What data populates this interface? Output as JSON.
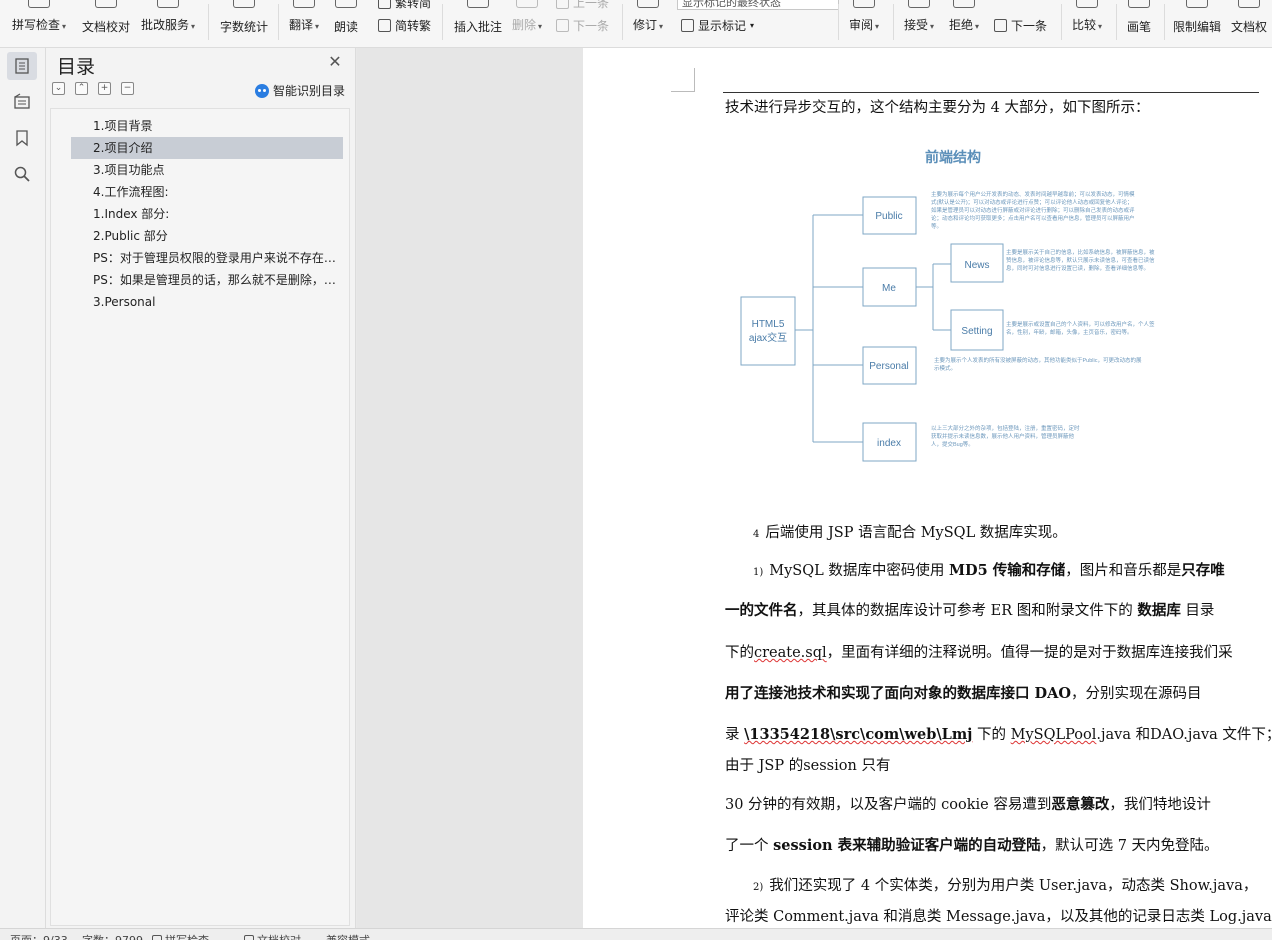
{
  "ribbon": {
    "items": [
      {
        "label": "拼写检查",
        "caret": true,
        "disabled": false
      },
      {
        "label": "文档校对",
        "caret": false,
        "disabled": false
      },
      {
        "label": "批改服务",
        "caret": true,
        "disabled": false
      },
      {
        "label": "字数统计",
        "caret": false,
        "disabled": false
      },
      {
        "label": "翻译",
        "caret": true,
        "disabled": false
      },
      {
        "label": "朗读",
        "caret": false,
        "disabled": false
      },
      {
        "label": "插入批注",
        "caret": false,
        "disabled": false
      },
      {
        "label": "删除",
        "caret": true,
        "disabled": true
      },
      {
        "label": "修订",
        "caret": true,
        "disabled": false
      },
      {
        "label": "审阅",
        "caret": true,
        "disabled": false
      },
      {
        "label": "接受",
        "caret": true,
        "disabled": false
      },
      {
        "label": "拒绝",
        "caret": true,
        "disabled": false
      },
      {
        "label": "比较",
        "caret": true,
        "disabled": false
      },
      {
        "label": "画笔",
        "caret": false,
        "disabled": false
      },
      {
        "label": "限制编辑",
        "caret": false,
        "disabled": false
      },
      {
        "label": "文档权",
        "caret": false,
        "disabled": false
      }
    ],
    "fan_jian": "繁转简",
    "jian_fan": "简转繁",
    "prev_comment": "上一条",
    "next_comment": "下一条",
    "next_change": "下一条",
    "show_markup": "显示标记",
    "markup_combo": "显示标记的最终状态"
  },
  "toc": {
    "title": "目录",
    "ai_label": "智能识别目录",
    "items": [
      {
        "label": "1.项目背景",
        "selected": false
      },
      {
        "label": "2.项目介绍",
        "selected": true
      },
      {
        "label": "3.项目功能点",
        "selected": false
      },
      {
        "label": "4.工作流程图:",
        "selected": false
      },
      {
        "label": "1.Index 部分:",
        "selected": false
      },
      {
        "label": "2.Public 部分",
        "selected": false
      },
      {
        "label": "PS：对于管理员权限的登录用户来说不存在屏蔽",
        "selected": false
      },
      {
        "label": "PS：如果是管理员的话，那么就不是删除，而是屏蔽",
        "selected": false
      },
      {
        "label": "3.Personal",
        "selected": false
      }
    ]
  },
  "document": {
    "line1": "技术进行异步交互的，这个结构主要分为 4 大部分，如下图所示：",
    "item4_num": "4",
    "item4_text": "后端使用 JSP 语言配合 MySQL 数据库实现。",
    "sub1_num": "1)",
    "p1_a": "MySQL 数据库中密码使用 ",
    "p1_b": "MD5 传输和存储",
    "p1_c": "，图片和音乐都是",
    "p1_d": "只存唯",
    "p2_a": "一的文件名",
    "p2_b": "，其具体的数据库设计可参考 ER 图和附录文件下的 ",
    "p2_c": "数据库",
    "p2_d": " 目录",
    "p3_a": "下的",
    "p3_b": "create.sql",
    "p3_c": "，里面有详细的注释说明。值得一提的是对于数据库连接我们采",
    "p4_a": "用了连接池技术和实现了面向对象的数据库接口 DAO",
    "p4_b": "，分别实现在源码目",
    "p5_a": "录 ",
    "p5_b": "\\13354218\\src\\com\\web\\Lmj",
    "p5_c": " 下的 ",
    "p5_d": "MySQLPool",
    "p5_e": ".java 和DAO.java 文件下；此外",
    "p6": "由于 JSP 的session 只有",
    "p7_a": "30 分钟的有效期，以及客户端的 cookie 容易遭到",
    "p7_b": "恶意篡改",
    "p7_c": "，我们特地设计",
    "p8_a": "了一个 ",
    "p8_b": "session 表来辅助验证客户端的自动登陆",
    "p8_c": "，默认可选 7 天内免登陆。",
    "sub2_num": "2)",
    "p9": "我们还实现了 4 个实体类，分别为用户类 User.java，动态类 Show.java，",
    "p10": "评论类 Comment.java 和消息类 Message.java，以及其他的记录日志类 Log.java，"
  },
  "diagram": {
    "title": "前端结构",
    "root": "HTML5",
    "root2": "ajax交互",
    "nodes": [
      "Public",
      "Me",
      "Personal",
      "index"
    ],
    "sub_nodes": [
      "News",
      "Setting"
    ],
    "desc_public": [
      "主要为展示每个用户公开发表的动态、发表时间越早越靠前；可以发表动态，可情模",
      "式(默认是公开)；可以对动态或评论进行点赞；可以评论他人动态或回复他人评论；",
      "如果是管理员可以对动态进行屏蔽或对评论进行删除；可以删除自己发表的动态或评",
      "论；动态和评论均可获取更多；点击用户名可以查看用户信息，管理员可以屏蔽用户",
      "等。"
    ],
    "desc_news": [
      "主要是展示关于自己的信息，比如系统信息，被屏蔽信息，被",
      "赞信息，被评论信息等，默认只展示未读信息，可查看已读信",
      "息，同时可对信息进行设置已读，删除，查看详细信息等。"
    ],
    "desc_setting": [
      "主要是展示或设置自己的个人资料，可以修改用户名，个人签",
      "名，性别，年龄，邮箱，头像，主页音乐，密码等。"
    ],
    "desc_personal": [
      "主要为展示个人发表的所有没被屏蔽的动态，其他功能类似于Public，可更改动态的展",
      "示模式。"
    ],
    "desc_index": [
      "以上三大部分之外的杂项，包括登陆，注册，重置密码，定时",
      "获取并提示未读信息数，展示他人用户资料，管理员屏蔽他",
      "人，提交Bug等。"
    ]
  },
  "status": {
    "page": "页面：9/33",
    "words": "字数：9799",
    "spell": "拼写检查",
    "proof": "文档校对",
    "compat": "兼容模式"
  },
  "colors": {
    "accent": "#2a7de1",
    "diagram_line": "#7fa7c6",
    "diagram_title": "#5b8fb9"
  }
}
